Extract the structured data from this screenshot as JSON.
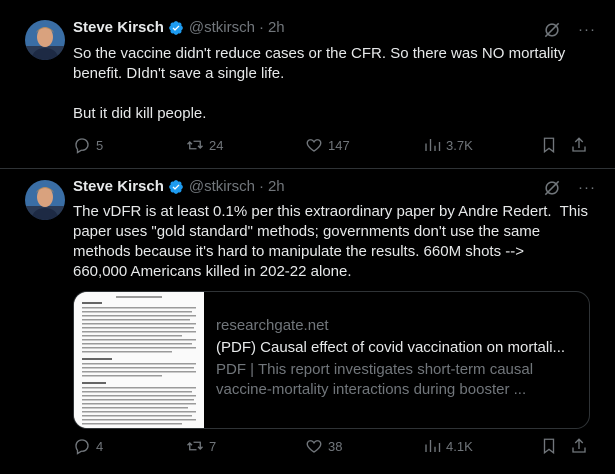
{
  "tweets": [
    {
      "name": "Steve Kirsch",
      "handle": "@stkirsch",
      "time": "2h",
      "text": "So the vaccine didn't reduce cases or the CFR. So there was NO mortality\nbenefit. DIdn't save a single life.\n\nBut it did kill people.",
      "replies": "5",
      "reposts": "24",
      "likes": "147",
      "views": "3.7K"
    },
    {
      "name": "Steve Kirsch",
      "handle": "@stkirsch",
      "time": "2h",
      "text": "The vDFR is at least 0.1% per this extraordinary paper by Andre Redert.  This\npaper uses \"gold standard\" methods; governments don't use the same\nmethods because it's hard to manipulate the results. 660M shots -->\n660,000 Americans killed in 202-22 alone.",
      "card": {
        "domain": "researchgate.net",
        "title": "(PDF) Causal effect of covid vaccination on mortali...",
        "description": "PDF | This report investigates short-term causal\nvaccine-mortality interactions during booster ..."
      },
      "replies": "4",
      "reposts": "7",
      "likes": "38",
      "views": "4.1K"
    }
  ],
  "colors": {
    "background": "#000000",
    "text": "#e7e9ea",
    "muted": "#71767b",
    "verified": "#1d9bf0",
    "border": "#2f3336"
  },
  "icons": [
    "verified-badge-icon",
    "grok-icon",
    "more-icon",
    "reply-icon",
    "repost-icon",
    "like-icon",
    "views-icon",
    "bookmark-icon",
    "share-icon"
  ]
}
